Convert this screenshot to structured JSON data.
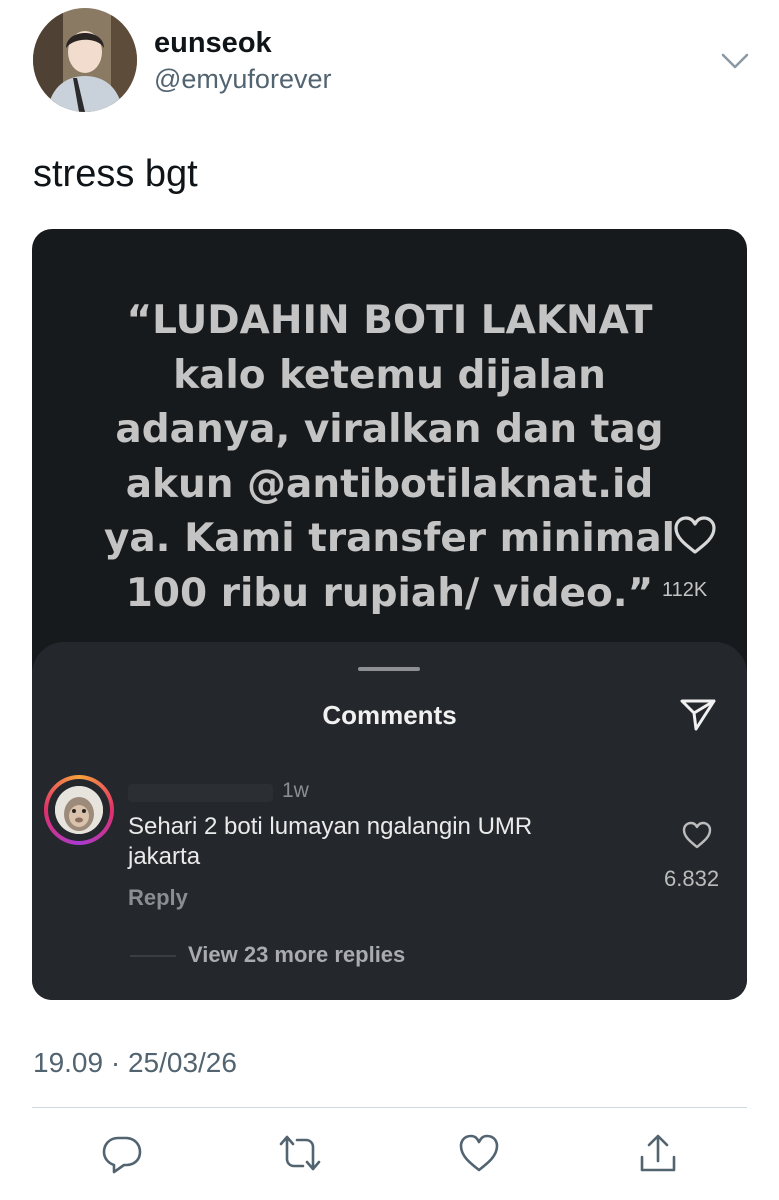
{
  "author": {
    "display_name": "eunseok",
    "handle": "@emyuforever"
  },
  "tweet": {
    "text": "stress bgt",
    "timestamp": "19.09 · 25/03/26"
  },
  "media": {
    "quote_lines": [
      "“LUDAHIN BOTI LAKNAT",
      "kalo ketemu dijalan",
      "adanya, viralkan dan tag",
      "akun @antibotilaknat.id",
      "ya. Kami transfer minimal",
      "100 ribu rupiah/ video.”"
    ],
    "likes": "112K",
    "comments_sheet": {
      "title": "Comments",
      "comment": {
        "time": "1w",
        "text": "Sehari 2 boti lumayan ngalangin UMR jakarta",
        "reply_label": "Reply",
        "likes": "6.832"
      },
      "view_more": "View 23 more replies"
    }
  },
  "actions": {
    "icons": [
      "reply-icon",
      "retweet-icon",
      "like-icon",
      "share-icon"
    ]
  },
  "colors": {
    "background": "#ffffff",
    "text_primary": "#0f1419",
    "text_secondary": "#536471",
    "media_bg": "#161a1c",
    "sheet_bg": "#24272c"
  }
}
